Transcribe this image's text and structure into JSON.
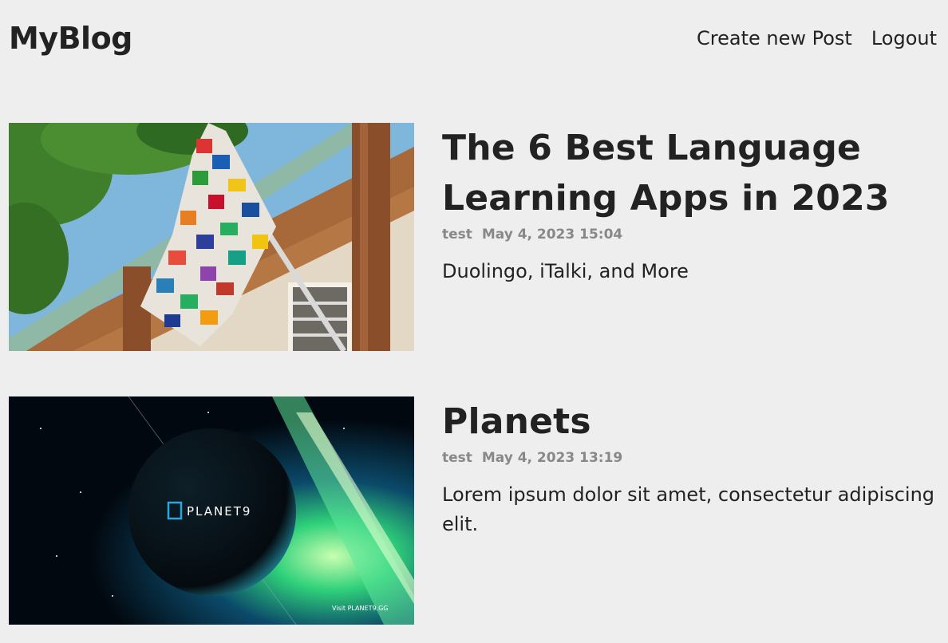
{
  "header": {
    "logo": "MyBlog",
    "nav": {
      "create": "Create new Post",
      "logout": "Logout"
    }
  },
  "posts": [
    {
      "title": "The 6 Best Language Learning Apps in 2023",
      "author": "test",
      "time": "May 4, 2023 15:04",
      "summary": "Duolingo, iTalki, and More",
      "image": "flags-of-the-world-on-porch"
    },
    {
      "title": "Planets",
      "author": "test",
      "time": "May 4, 2023 13:19",
      "summary": "Lorem ipsum dolor sit amet, consectetur adipiscing elit.",
      "image": "planet9-space-art",
      "image_brand": "PLANET9",
      "image_caption": "Visit PLANET9.GG"
    }
  ]
}
